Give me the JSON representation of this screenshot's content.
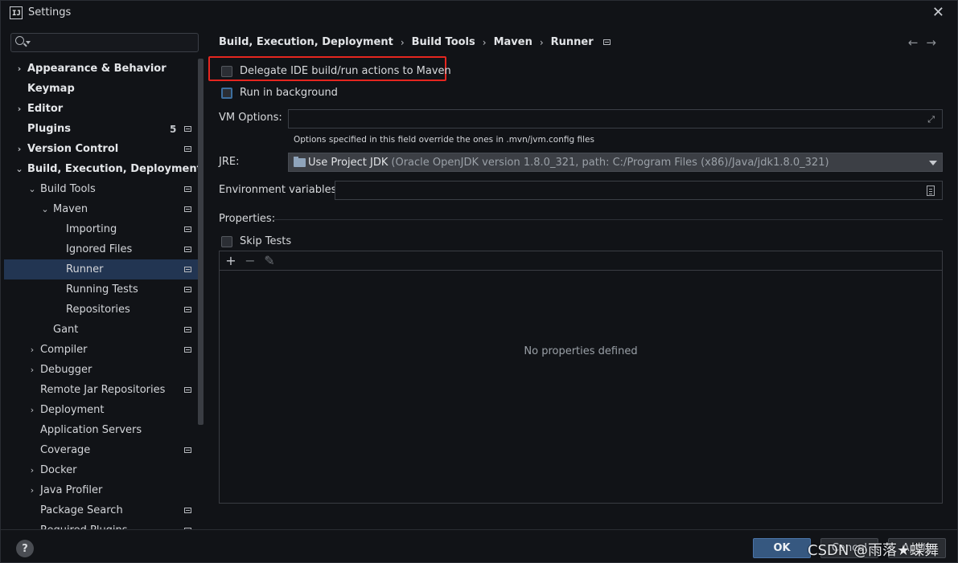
{
  "window": {
    "title": "Settings",
    "logo": "IJ"
  },
  "search": {
    "placeholder": ""
  },
  "sidebar": {
    "items": [
      {
        "label": "Appearance & Behavior",
        "arrow": "›",
        "bold": true
      },
      {
        "label": "Keymap",
        "arrow": "",
        "bold": true
      },
      {
        "label": "Editor",
        "arrow": "›",
        "bold": true
      },
      {
        "label": "Plugins",
        "arrow": "",
        "bold": true,
        "badge": "5"
      },
      {
        "label": "Version Control",
        "arrow": "›",
        "bold": true
      },
      {
        "label": "Build, Execution, Deployment",
        "arrow": "⌄",
        "bold": true
      },
      {
        "label": "Build Tools",
        "arrow": "⌄"
      },
      {
        "label": "Maven",
        "arrow": "⌄"
      },
      {
        "label": "Importing",
        "arrow": ""
      },
      {
        "label": "Ignored Files",
        "arrow": ""
      },
      {
        "label": "Runner",
        "arrow": "",
        "selected": true
      },
      {
        "label": "Running Tests",
        "arrow": ""
      },
      {
        "label": "Repositories",
        "arrow": ""
      },
      {
        "label": "Gant",
        "arrow": ""
      },
      {
        "label": "Compiler",
        "arrow": "›"
      },
      {
        "label": "Debugger",
        "arrow": "›"
      },
      {
        "label": "Remote Jar Repositories",
        "arrow": ""
      },
      {
        "label": "Deployment",
        "arrow": "›"
      },
      {
        "label": "Application Servers",
        "arrow": ""
      },
      {
        "label": "Coverage",
        "arrow": ""
      },
      {
        "label": "Docker",
        "arrow": "›"
      },
      {
        "label": "Java Profiler",
        "arrow": "›"
      },
      {
        "label": "Package Search",
        "arrow": ""
      },
      {
        "label": "Required Plugins",
        "arrow": ""
      }
    ]
  },
  "breadcrumb": [
    "Build, Execution, Deployment",
    "Build Tools",
    "Maven",
    "Runner"
  ],
  "breadcrumb_sep": "›",
  "nav": {
    "back": "←",
    "forward": "→"
  },
  "runner": {
    "delegate_label": "Delegate IDE build/run actions to Maven",
    "delegate_checked": false,
    "background_label": "Run in background",
    "background_checked": false,
    "vm_options_label": "VM Options:",
    "vm_options_value": "",
    "vm_hint": "Options specified in this field override the ones in .mvn/jvm.config files",
    "jre_label": "JRE:",
    "jre_value": "Use Project JDK",
    "jre_detail": "(Oracle OpenJDK version 1.8.0_321, path: C:/Program Files (x86)/Java/jdk1.8.0_321)",
    "env_label": "Environment variables:",
    "env_value": "",
    "properties_label": "Properties:",
    "skip_tests_label": "Skip Tests",
    "skip_tests_checked": false,
    "toolbar": {
      "add": "+",
      "remove": "−",
      "edit": "✎"
    },
    "empty_text": "No properties defined"
  },
  "footer": {
    "help": "?",
    "ok": "OK",
    "cancel": "Cancel",
    "apply": "Apply",
    "watermark": "CSDN @雨落★蝶舞"
  },
  "colors": {
    "selection": "#223552",
    "highlight_box": "#e5261f",
    "ok_button": "#365880"
  }
}
